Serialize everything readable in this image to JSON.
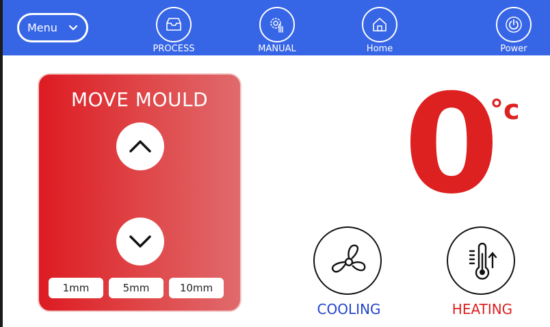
{
  "header": {
    "menu_label": "Menu",
    "nav": [
      {
        "label": "PROCESS",
        "icon": "inbox-tray-icon"
      },
      {
        "label": "MANUAL",
        "icon": "settings-hand-icon"
      },
      {
        "label": "Home",
        "icon": "home-icon"
      },
      {
        "label": "Power",
        "icon": "power-icon"
      }
    ]
  },
  "mould": {
    "title": "MOVE MOULD",
    "up_icon": "chevron-up-icon",
    "down_icon": "chevron-down-icon",
    "steps": [
      "1mm",
      "5mm",
      "10mm"
    ]
  },
  "temperature": {
    "value": "0",
    "unit": "°c",
    "color": "#dd2020"
  },
  "controls": {
    "cooling": {
      "label": "COOLING",
      "icon": "fan-icon",
      "color": "#2244cc"
    },
    "heating": {
      "label": "HEATING",
      "icon": "thermometer-up-icon",
      "color": "#dd2020"
    }
  },
  "colors": {
    "header": "#3665e6",
    "panel_start": "#dd1b22",
    "panel_end": "#e06a6c"
  }
}
